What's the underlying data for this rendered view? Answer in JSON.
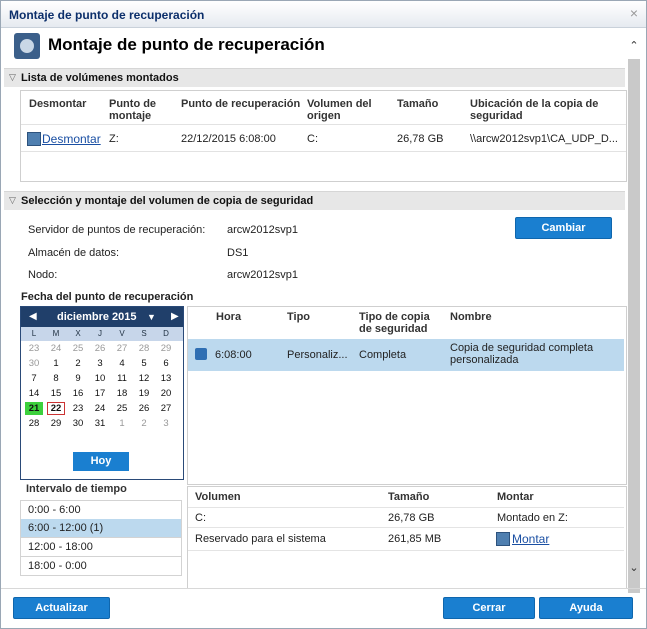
{
  "window": {
    "title": "Montaje de punto de recuperación",
    "close_glyph": "×"
  },
  "header": {
    "title": "Montaje de punto de recuperación",
    "icon": "mount-disk-icon"
  },
  "mounted": {
    "section_label": "Lista de volúmenes montados",
    "columns": [
      "Desmontar",
      "Punto de montaje",
      "Punto de recuperación",
      "Volumen del origen",
      "Tamaño",
      "Ubicación de la copia de seguridad"
    ],
    "rows": [
      {
        "action": "Desmontar",
        "mount_point": "Z:",
        "recovery_point": "22/12/2015 6:08:00",
        "source_volume": "C:",
        "size": "26,78 GB",
        "location": "\\\\arcw2012svp1\\CA_UDP_D..."
      }
    ]
  },
  "selection": {
    "section_label": "Selección y montaje del volumen de copia de seguridad",
    "server_label": "Servidor de puntos de recuperación:",
    "server_value": "arcw2012svp1",
    "datastore_label": "Almacén de datos:",
    "datastore_value": "DS1",
    "node_label": "Nodo:",
    "node_value": "arcw2012svp1",
    "change_button": "Cambiar",
    "date_label": "Fecha del punto de recuperación"
  },
  "calendar": {
    "month": "diciembre 2015",
    "weekdays": [
      "L",
      "M",
      "X",
      "J",
      "V",
      "S",
      "D"
    ],
    "weeks": [
      [
        "23",
        "24",
        "25",
        "26",
        "27",
        "28",
        "29"
      ],
      [
        "30",
        "1",
        "2",
        "3",
        "4",
        "5",
        "6"
      ],
      [
        "7",
        "8",
        "9",
        "10",
        "11",
        "12",
        "13"
      ],
      [
        "14",
        "15",
        "16",
        "17",
        "18",
        "19",
        "20"
      ],
      [
        "21",
        "22",
        "23",
        "24",
        "25",
        "26",
        "27"
      ],
      [
        "28",
        "29",
        "30",
        "31",
        "1",
        "2",
        "3"
      ]
    ],
    "selected_day": "21",
    "today_day": "22",
    "today_button": "Hoy"
  },
  "points": {
    "columns": [
      "Hora",
      "Tipo",
      "Tipo de copia de seguridad",
      "Nombre"
    ],
    "rows": [
      {
        "time": "6:08:00",
        "type": "Personaliz...",
        "backup_type": "Completa",
        "name": "Copia de seguridad completa personalizada"
      }
    ]
  },
  "interval": {
    "label": "Intervalo de tiempo",
    "items": [
      "0:00 - 6:00",
      "6:00 - 12:00   (1)",
      "12:00 - 18:00",
      "18:00 - 0:00"
    ],
    "selected_index": 1
  },
  "volumes": {
    "columns": [
      "Volumen",
      "Tamaño",
      "Montar"
    ],
    "rows": [
      {
        "volume": "C:",
        "size": "26,78 GB",
        "mount": "Montado en Z:"
      },
      {
        "volume": "Reservado para el sistema",
        "size": "261,85 MB",
        "mount": "Montar"
      }
    ]
  },
  "footer": {
    "refresh": "Actualizar",
    "close": "Cerrar",
    "help": "Ayuda"
  },
  "colors": {
    "accent": "#1a7fd0",
    "selected_row": "#bcd9ee",
    "selected_day": "#3cd03c",
    "title": "#0c2f6b"
  }
}
